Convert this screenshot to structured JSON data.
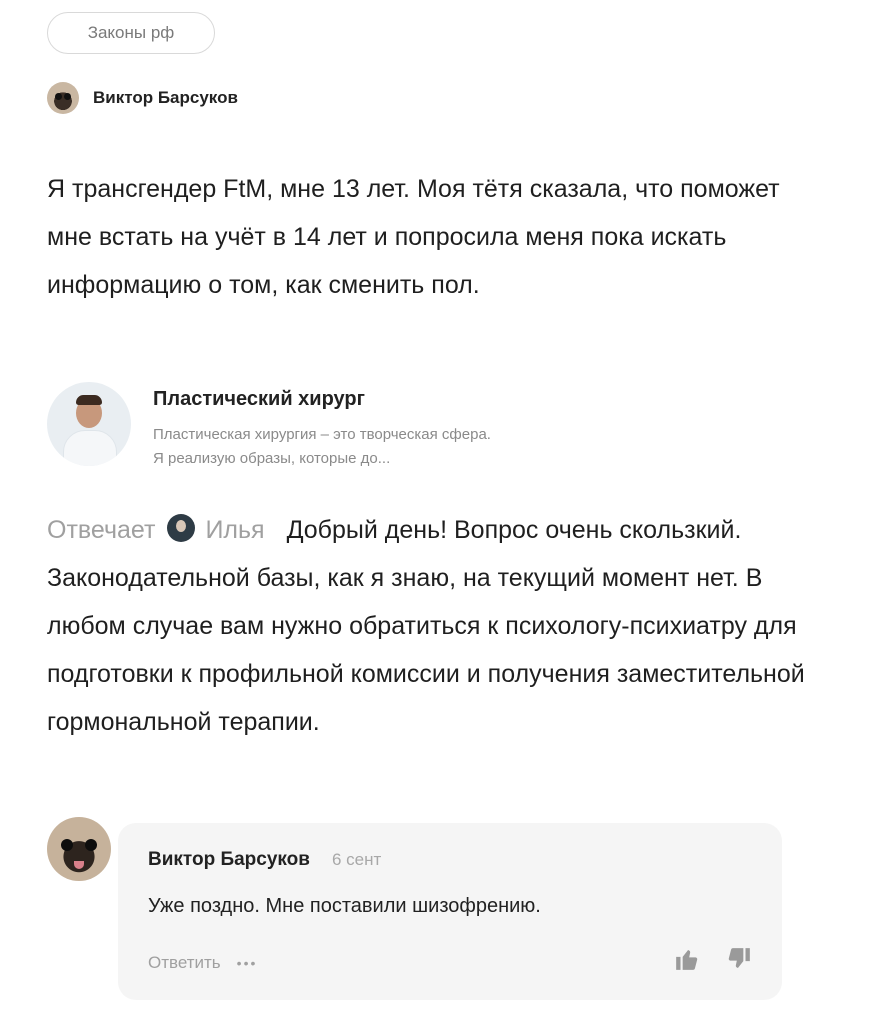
{
  "tag": "Законы рф",
  "question": {
    "author": "Виктор Барсуков",
    "text": "Я трансгендер FtM, мне 13 лет. Моя тётя сказала, что поможет мне встать на учёт в 14 лет и попросила меня пока искать информацию о том, как сменить пол."
  },
  "expert": {
    "title": "Пластический хирург",
    "bio_line1": "Пластическая хирургия – это творческая сфера.",
    "bio_line2": "Я реализую образы, которые до..."
  },
  "answer": {
    "prefix": "Отвечает",
    "answerer": "Илья",
    "text": "Добрый день! Вопрос очень скользкий. Законодательной базы, как я знаю, на текущий момент нет. В любом случае вам нужно обратиться к психологу-психиатру для подготовки к профильной комиссии и получения заместительной гормональной терапии."
  },
  "comment": {
    "author": "Виктор Барсуков",
    "date": "6 сент",
    "text": "Уже поздно. Мне поставили шизофрению.",
    "reply_label": "Ответить",
    "more_label": "•••"
  },
  "icons": {
    "more": "more-horizontal-icon",
    "like": "thumbs-up-icon",
    "dislike": "thumbs-down-icon"
  }
}
